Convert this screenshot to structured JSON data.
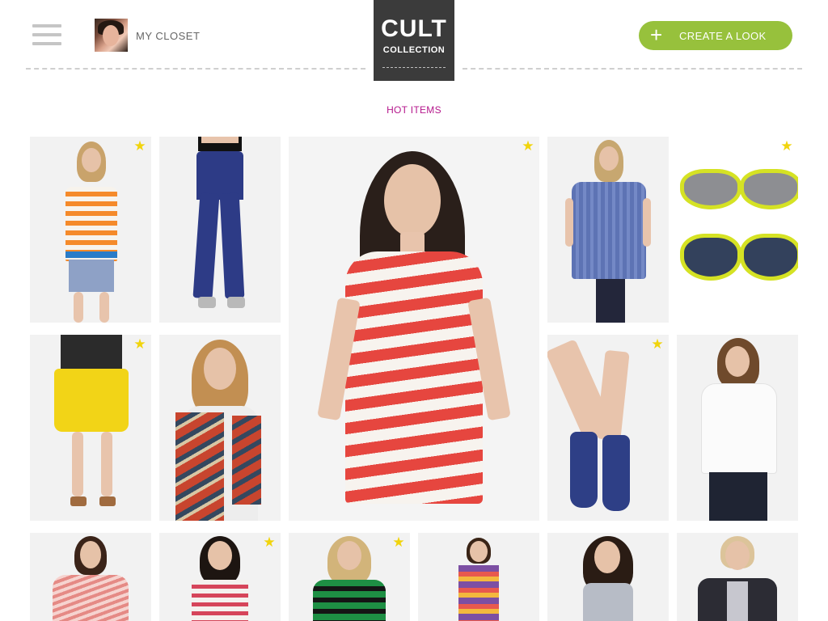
{
  "header": {
    "closet_label": "MY CLOSET",
    "logo_line1": "CULT",
    "logo_line2": "COLLECTION",
    "create_label": "CREATE A LOOK",
    "create_icon": "plus-icon",
    "accent_color": "#97c13c"
  },
  "section": {
    "title": "HOT ITEMS",
    "title_color": "#b5178c"
  },
  "favorite_icon": "star-icon",
  "favorite_color": "#f1d40c"
}
